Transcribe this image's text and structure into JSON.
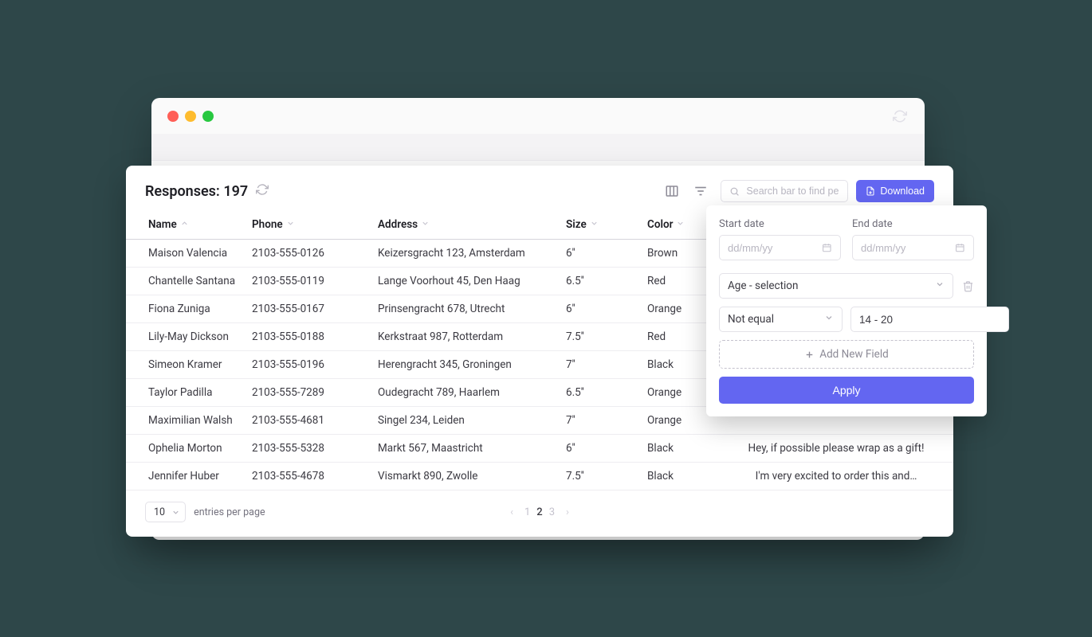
{
  "header": {
    "title_prefix": "Responses: ",
    "count": "197",
    "search_placeholder": "Search bar to find people",
    "download_label": "Download"
  },
  "columns": [
    "Name",
    "Phone",
    "Address",
    "Size",
    "Color"
  ],
  "rows": [
    {
      "name": "Maison Valencia",
      "phone": "2103-555-0126",
      "addr": "Keizersgracht 123, Amsterdam",
      "size": "6''",
      "color": "Brown",
      "msg": ""
    },
    {
      "name": "Chantelle Santana",
      "phone": "2103-555-0119",
      "addr": "Lange Voorhout 45, Den Haag",
      "size": "6.5''",
      "color": "Red",
      "msg": ""
    },
    {
      "name": "Fiona Zuniga",
      "phone": "2103-555-0167",
      "addr": "Prinsengracht 678, Utrecht",
      "size": "6''",
      "color": "Orange",
      "msg": ""
    },
    {
      "name": "Lily-May Dickson",
      "phone": "2103-555-0188",
      "addr": "Kerkstraat 987, Rotterdam",
      "size": "7.5''",
      "color": "Red",
      "msg": ""
    },
    {
      "name": "Simeon Kramer",
      "phone": "2103-555-0196",
      "addr": "Herengracht 345, Groningen",
      "size": "7''",
      "color": "Black",
      "msg": ""
    },
    {
      "name": "Taylor Padilla",
      "phone": "2103-555-7289",
      "addr": "Oudegracht 789, Haarlem",
      "size": "6.5''",
      "color": "Orange",
      "msg": ""
    },
    {
      "name": "Maximilian Walsh",
      "phone": "2103-555-4681",
      "addr": "Singel 234, Leiden",
      "size": "7''",
      "color": "Orange",
      "msg": ""
    },
    {
      "name": "Ophelia Morton",
      "phone": "2103-555-5328",
      "addr": "Markt 567, Maastricht",
      "size": "6''",
      "color": "Black",
      "msg": "Hey, if possible please wrap as a gift!"
    },
    {
      "name": "Jennifer Huber",
      "phone": "2103-555-4678",
      "addr": "Vismarkt 890, Zwolle",
      "size": "7.5''",
      "color": "Black",
      "msg": "I'm very excited to order this and…"
    }
  ],
  "footer": {
    "perpage_value": "10",
    "perpage_label": "entries per page",
    "pages": [
      "1",
      "2",
      "3"
    ],
    "active_page": "2"
  },
  "filter": {
    "start_label": "Start date",
    "end_label": "End date",
    "date_placeholder": "dd/mm/yy",
    "field_value": "Age - selection",
    "operator_value": "Not equal",
    "range_value": "14 - 20",
    "add_label": "Add New Field",
    "apply_label": "Apply"
  }
}
